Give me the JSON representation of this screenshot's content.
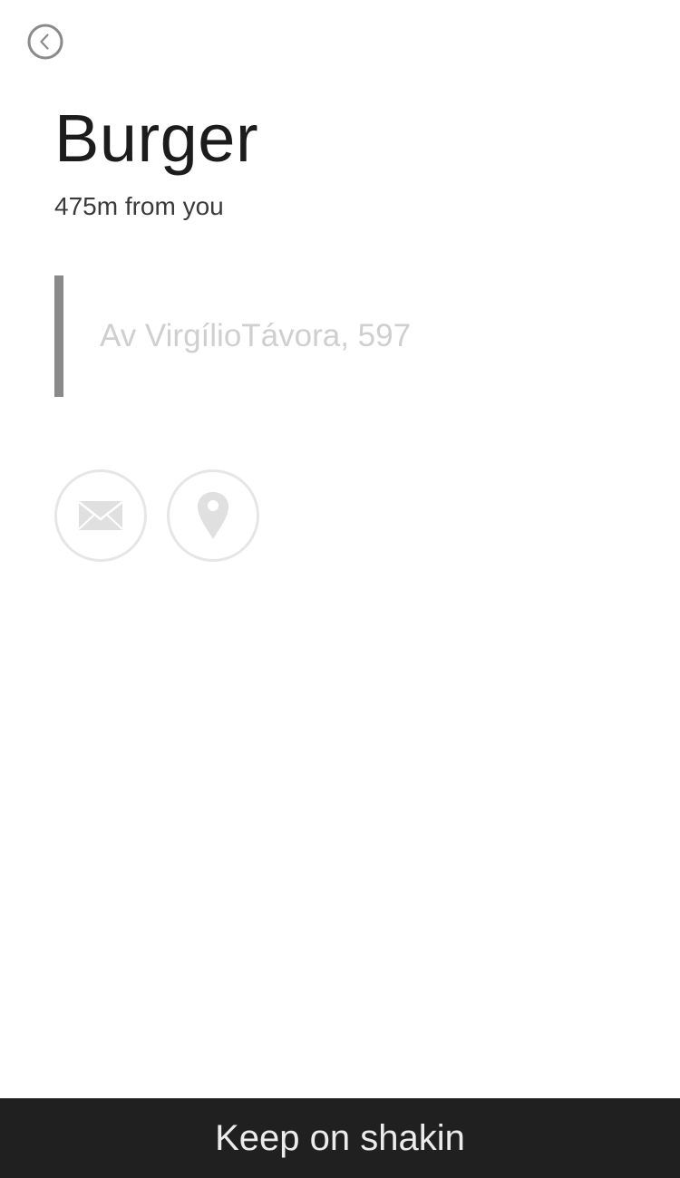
{
  "header": {
    "back_icon": "chevron-left-circle-icon"
  },
  "place": {
    "name": "Burger",
    "distance": "475m from you",
    "address": "Av VirgílioTávora, 597"
  },
  "actions": [
    {
      "icon": "envelope-icon"
    },
    {
      "icon": "map-pin-icon"
    }
  ],
  "footer": {
    "label": "Keep on shakin"
  },
  "colors": {
    "background": "#ffffff",
    "footer_background": "#202020",
    "accent_bar": "#8a8a8a",
    "icon_gray": "#e0e0e0"
  }
}
